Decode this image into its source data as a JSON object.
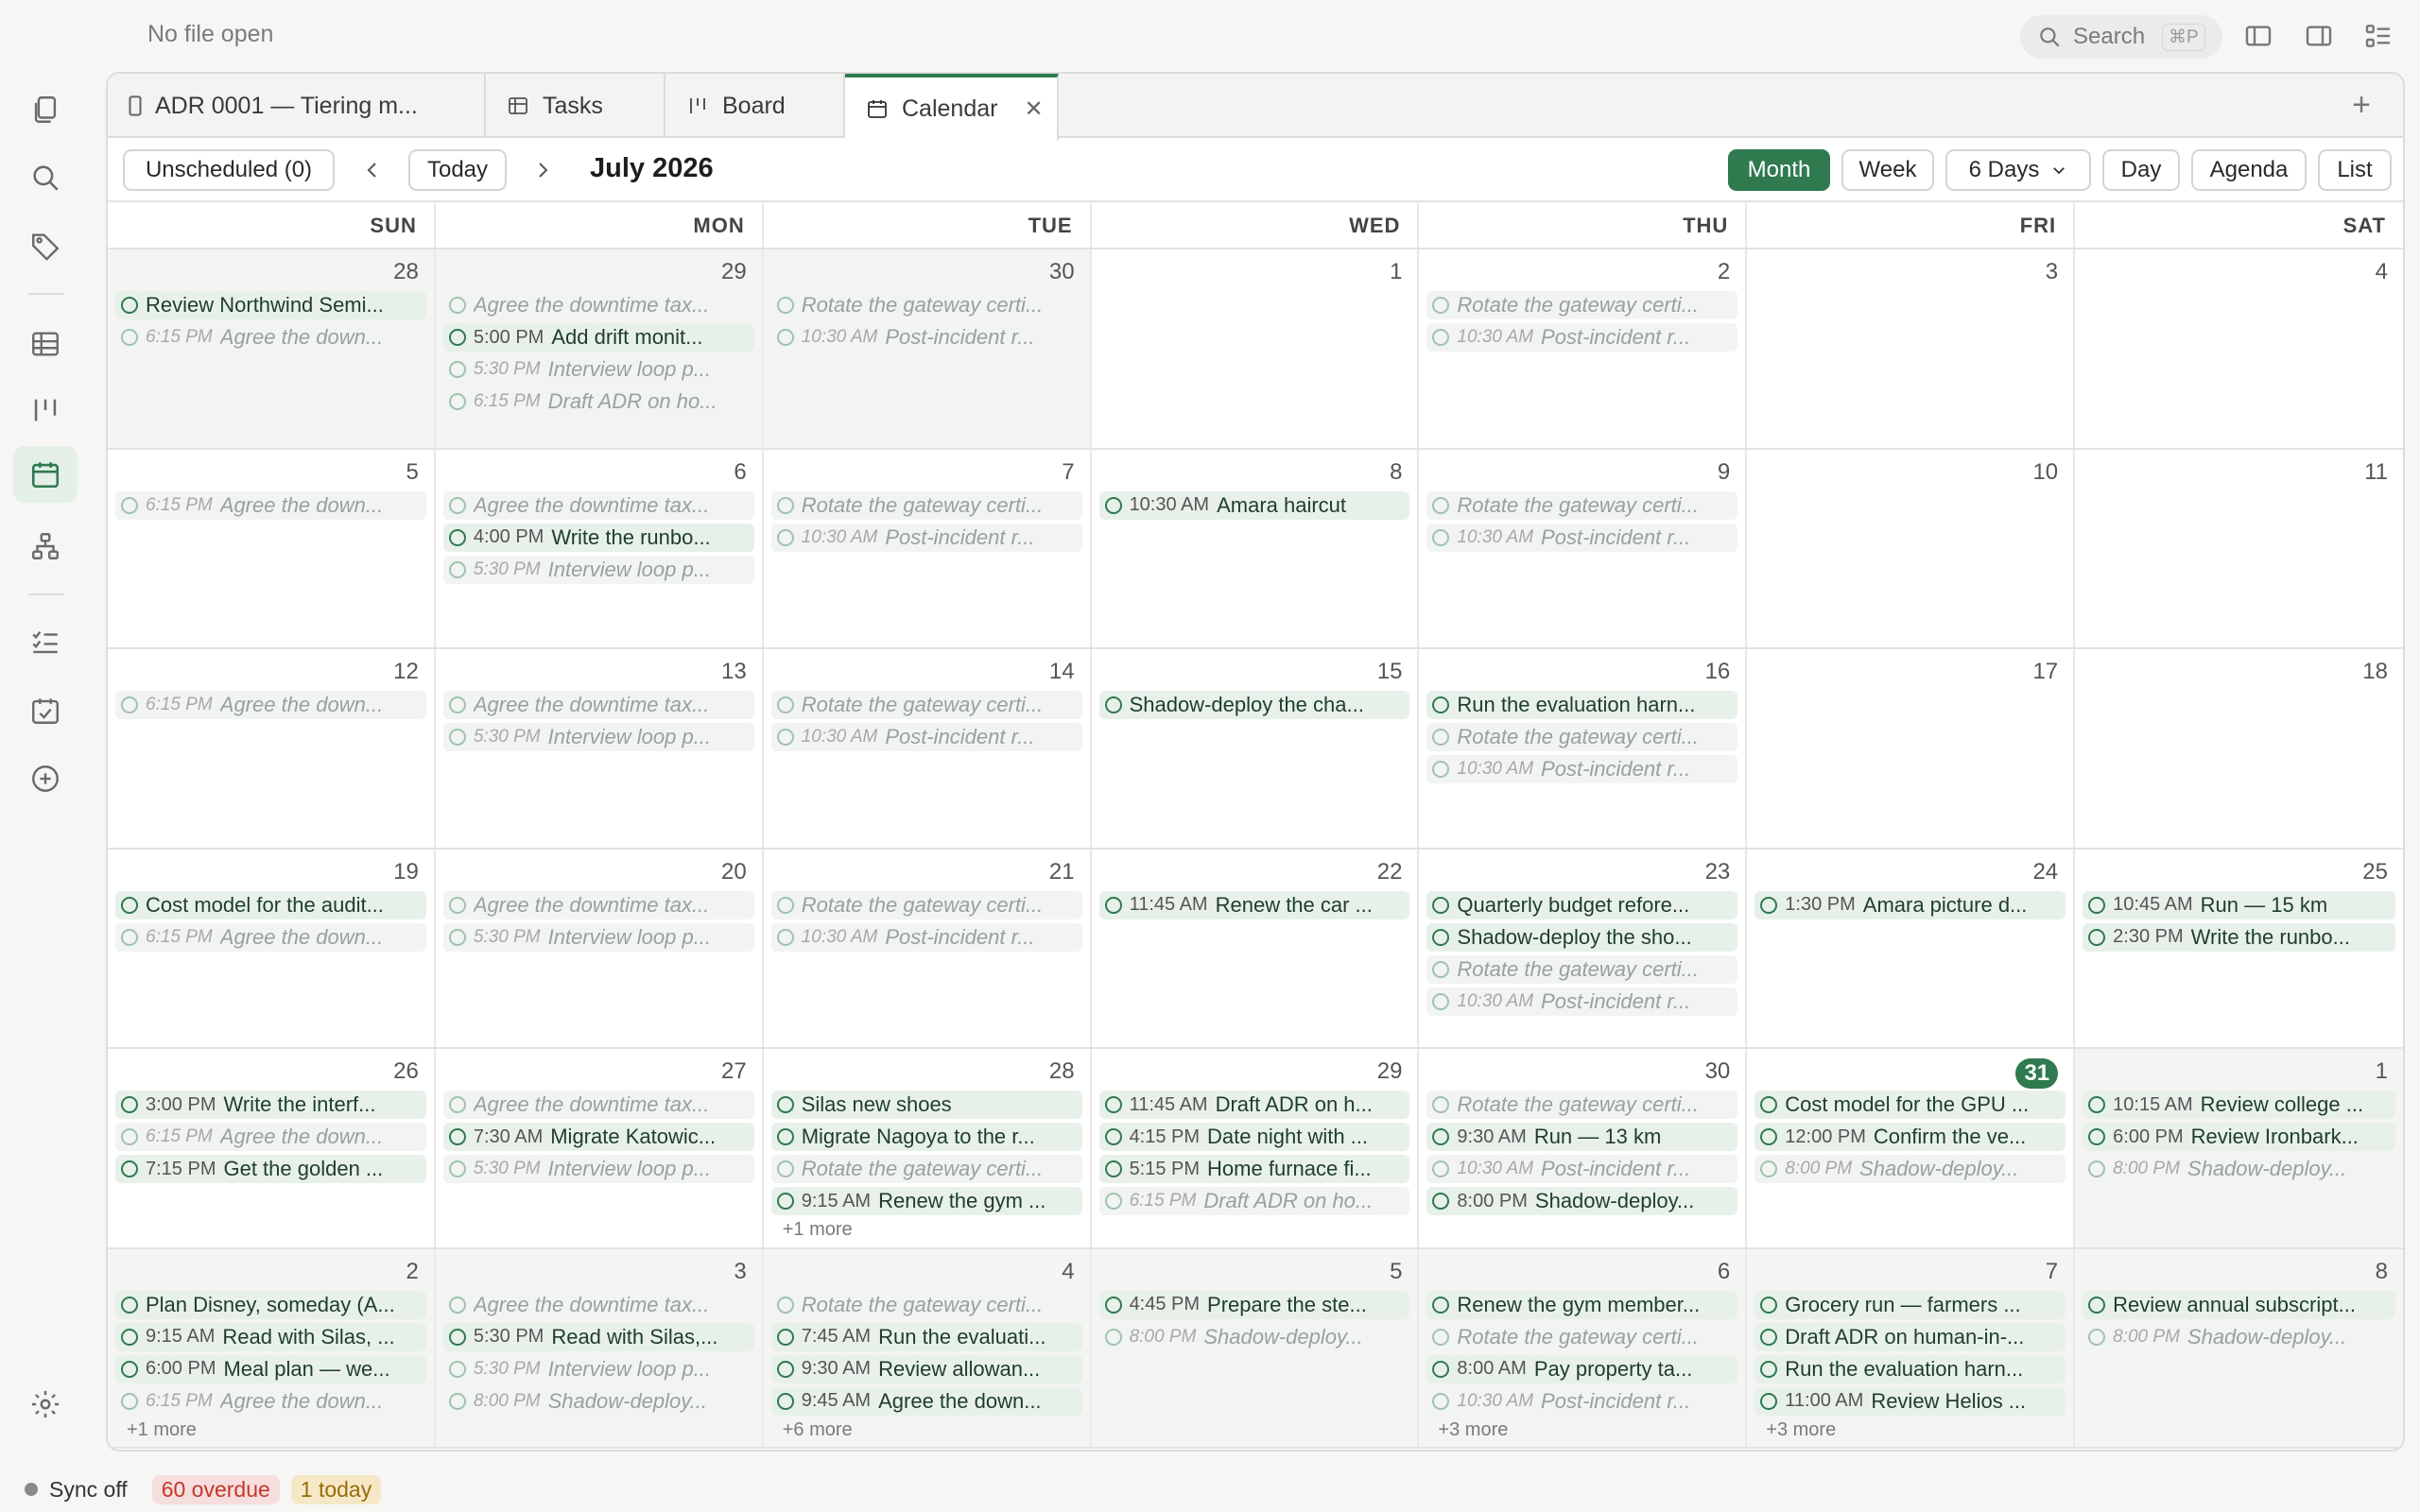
{
  "titlebar": {
    "file_status": "No file open",
    "search_label": "Search",
    "search_shortcut": "⌘P"
  },
  "tabs": [
    {
      "label": "ADR 0001 — Tiering m...",
      "icon": "file-icon"
    },
    {
      "label": "Tasks",
      "icon": "table-icon"
    },
    {
      "label": "Board",
      "icon": "board-icon"
    },
    {
      "label": "Calendar",
      "icon": "calendar-icon",
      "active": true
    }
  ],
  "toolbar": {
    "unscheduled": "Unscheduled (0)",
    "today": "Today",
    "title": "July 2026",
    "views": {
      "month": "Month",
      "week": "Week",
      "six_days": "6 Days",
      "day": "Day",
      "agenda": "Agenda",
      "list": "List"
    }
  },
  "days_of_week": [
    "SUN",
    "MON",
    "TUE",
    "WED",
    "THU",
    "FRI",
    "SAT"
  ],
  "weeks": [
    [
      {
        "day": "28",
        "other": true,
        "events": [
          {
            "title": "Review Northwind Semi...",
            "time": "",
            "style": "active"
          },
          {
            "title": "Agree the down...",
            "time": "6:15 PM",
            "style": "faded"
          }
        ]
      },
      {
        "day": "29",
        "other": true,
        "events": [
          {
            "title": "Agree the downtime tax...",
            "time": "",
            "style": "faded"
          },
          {
            "title": "Add drift monit...",
            "time": "5:00 PM",
            "style": "active"
          },
          {
            "title": "Interview loop p...",
            "time": "5:30 PM",
            "style": "faded"
          },
          {
            "title": "Draft ADR on ho...",
            "time": "6:15 PM",
            "style": "faded"
          }
        ]
      },
      {
        "day": "30",
        "other": true,
        "events": [
          {
            "title": "Rotate the gateway certi...",
            "time": "",
            "style": "faded"
          },
          {
            "title": "Post-incident r...",
            "time": "10:30 AM",
            "style": "faded"
          }
        ]
      },
      {
        "day": "1",
        "events": []
      },
      {
        "day": "2",
        "events": [
          {
            "title": "Rotate the gateway certi...",
            "time": "",
            "style": "faded"
          },
          {
            "title": "Post-incident r...",
            "time": "10:30 AM",
            "style": "faded"
          }
        ]
      },
      {
        "day": "3",
        "events": []
      },
      {
        "day": "4",
        "events": []
      }
    ],
    [
      {
        "day": "5",
        "events": [
          {
            "title": "Agree the down...",
            "time": "6:15 PM",
            "style": "faded"
          }
        ]
      },
      {
        "day": "6",
        "events": [
          {
            "title": "Agree the downtime tax...",
            "time": "",
            "style": "faded"
          },
          {
            "title": "Write the runbo...",
            "time": "4:00 PM",
            "style": "active"
          },
          {
            "title": "Interview loop p...",
            "time": "5:30 PM",
            "style": "faded"
          }
        ]
      },
      {
        "day": "7",
        "events": [
          {
            "title": "Rotate the gateway certi...",
            "time": "",
            "style": "faded"
          },
          {
            "title": "Post-incident r...",
            "time": "10:30 AM",
            "style": "faded"
          }
        ]
      },
      {
        "day": "8",
        "events": [
          {
            "title": "Amara haircut",
            "time": "10:30 AM",
            "style": "active"
          }
        ]
      },
      {
        "day": "9",
        "events": [
          {
            "title": "Rotate the gateway certi...",
            "time": "",
            "style": "faded"
          },
          {
            "title": "Post-incident r...",
            "time": "10:30 AM",
            "style": "faded"
          }
        ]
      },
      {
        "day": "10",
        "events": []
      },
      {
        "day": "11",
        "events": []
      }
    ],
    [
      {
        "day": "12",
        "events": [
          {
            "title": "Agree the down...",
            "time": "6:15 PM",
            "style": "faded"
          }
        ]
      },
      {
        "day": "13",
        "events": [
          {
            "title": "Agree the downtime tax...",
            "time": "",
            "style": "faded"
          },
          {
            "title": "Interview loop p...",
            "time": "5:30 PM",
            "style": "faded"
          }
        ]
      },
      {
        "day": "14",
        "events": [
          {
            "title": "Rotate the gateway certi...",
            "time": "",
            "style": "faded"
          },
          {
            "title": "Post-incident r...",
            "time": "10:30 AM",
            "style": "faded"
          }
        ]
      },
      {
        "day": "15",
        "events": [
          {
            "title": "Shadow-deploy the cha...",
            "time": "",
            "style": "active"
          }
        ]
      },
      {
        "day": "16",
        "events": [
          {
            "title": "Run the evaluation harn...",
            "time": "",
            "style": "active"
          },
          {
            "title": "Rotate the gateway certi...",
            "time": "",
            "style": "faded"
          },
          {
            "title": "Post-incident r...",
            "time": "10:30 AM",
            "style": "faded"
          }
        ]
      },
      {
        "day": "17",
        "events": []
      },
      {
        "day": "18",
        "events": []
      }
    ],
    [
      {
        "day": "19",
        "events": [
          {
            "title": "Cost model for the audit...",
            "time": "",
            "style": "active"
          },
          {
            "title": "Agree the down...",
            "time": "6:15 PM",
            "style": "faded"
          }
        ]
      },
      {
        "day": "20",
        "events": [
          {
            "title": "Agree the downtime tax...",
            "time": "",
            "style": "faded"
          },
          {
            "title": "Interview loop p...",
            "time": "5:30 PM",
            "style": "faded"
          }
        ]
      },
      {
        "day": "21",
        "events": [
          {
            "title": "Rotate the gateway certi...",
            "time": "",
            "style": "faded"
          },
          {
            "title": "Post-incident r...",
            "time": "10:30 AM",
            "style": "faded"
          }
        ]
      },
      {
        "day": "22",
        "events": [
          {
            "title": "Renew the car ...",
            "time": "11:45 AM",
            "style": "active"
          }
        ]
      },
      {
        "day": "23",
        "events": [
          {
            "title": "Quarterly budget refore...",
            "time": "",
            "style": "active"
          },
          {
            "title": "Shadow-deploy the sho...",
            "time": "",
            "style": "active"
          },
          {
            "title": "Rotate the gateway certi...",
            "time": "",
            "style": "faded"
          },
          {
            "title": "Post-incident r...",
            "time": "10:30 AM",
            "style": "faded"
          }
        ]
      },
      {
        "day": "24",
        "events": [
          {
            "title": "Amara picture d...",
            "time": "1:30 PM",
            "style": "active"
          }
        ]
      },
      {
        "day": "25",
        "events": [
          {
            "title": "Run — 15 km",
            "time": "10:45 AM",
            "style": "active"
          },
          {
            "title": "Write the runbo...",
            "time": "2:30 PM",
            "style": "active"
          }
        ]
      }
    ],
    [
      {
        "day": "26",
        "events": [
          {
            "title": "Write the interf...",
            "time": "3:00 PM",
            "style": "active"
          },
          {
            "title": "Agree the down...",
            "time": "6:15 PM",
            "style": "faded"
          },
          {
            "title": "Get the golden ...",
            "time": "7:15 PM",
            "style": "active"
          }
        ]
      },
      {
        "day": "27",
        "events": [
          {
            "title": "Agree the downtime tax...",
            "time": "",
            "style": "faded"
          },
          {
            "title": "Migrate Katowic...",
            "time": "7:30 AM",
            "style": "active"
          },
          {
            "title": "Interview loop p...",
            "time": "5:30 PM",
            "style": "faded"
          }
        ]
      },
      {
        "day": "28",
        "more": "+1 more",
        "events": [
          {
            "title": "Silas new shoes",
            "time": "",
            "style": "active"
          },
          {
            "title": "Migrate Nagoya to the r...",
            "time": "",
            "style": "active"
          },
          {
            "title": "Rotate the gateway certi...",
            "time": "",
            "style": "faded"
          },
          {
            "title": "Renew the gym ...",
            "time": "9:15 AM",
            "style": "active"
          }
        ]
      },
      {
        "day": "29",
        "events": [
          {
            "title": "Draft ADR on h...",
            "time": "11:45 AM",
            "style": "active"
          },
          {
            "title": "Date night with ...",
            "time": "4:15 PM",
            "style": "active"
          },
          {
            "title": "Home furnace fi...",
            "time": "5:15 PM",
            "style": "active"
          },
          {
            "title": "Draft ADR on ho...",
            "time": "6:15 PM",
            "style": "faded"
          }
        ]
      },
      {
        "day": "30",
        "events": [
          {
            "title": "Rotate the gateway certi...",
            "time": "",
            "style": "faded"
          },
          {
            "title": "Run — 13 km",
            "time": "9:30 AM",
            "style": "active"
          },
          {
            "title": "Post-incident r...",
            "time": "10:30 AM",
            "style": "faded"
          },
          {
            "title": "Shadow-deploy...",
            "time": "8:00 PM",
            "style": "active"
          }
        ]
      },
      {
        "day": "31",
        "today": true,
        "events": [
          {
            "title": "Cost model for the GPU ...",
            "time": "",
            "style": "active"
          },
          {
            "title": "Confirm the ve...",
            "time": "12:00 PM",
            "style": "active"
          },
          {
            "title": "Shadow-deploy...",
            "time": "8:00 PM",
            "style": "faded"
          }
        ]
      },
      {
        "day": "1",
        "other": true,
        "events": [
          {
            "title": "Review college ...",
            "time": "10:15 AM",
            "style": "active"
          },
          {
            "title": "Review Ironbark...",
            "time": "6:00 PM",
            "style": "active"
          },
          {
            "title": "Shadow-deploy...",
            "time": "8:00 PM",
            "style": "faded"
          }
        ]
      }
    ],
    [
      {
        "day": "2",
        "other": true,
        "more": "+1 more",
        "events": [
          {
            "title": "Plan Disney, someday (A...",
            "time": "",
            "style": "active"
          },
          {
            "title": "Read with Silas, ...",
            "time": "9:15 AM",
            "style": "active"
          },
          {
            "title": "Meal plan — we...",
            "time": "6:00 PM",
            "style": "active"
          },
          {
            "title": "Agree the down...",
            "time": "6:15 PM",
            "style": "faded"
          }
        ]
      },
      {
        "day": "3",
        "other": true,
        "events": [
          {
            "title": "Agree the downtime tax...",
            "time": "",
            "style": "faded"
          },
          {
            "title": "Read with Silas,...",
            "time": "5:30 PM",
            "style": "active"
          },
          {
            "title": "Interview loop p...",
            "time": "5:30 PM",
            "style": "faded"
          },
          {
            "title": "Shadow-deploy...",
            "time": "8:00 PM",
            "style": "faded"
          }
        ]
      },
      {
        "day": "4",
        "other": true,
        "more": "+6 more",
        "events": [
          {
            "title": "Rotate the gateway certi...",
            "time": "",
            "style": "faded"
          },
          {
            "title": "Run the evaluati...",
            "time": "7:45 AM",
            "style": "active"
          },
          {
            "title": "Review allowan...",
            "time": "9:30 AM",
            "style": "active"
          },
          {
            "title": "Agree the down...",
            "time": "9:45 AM",
            "style": "active"
          }
        ]
      },
      {
        "day": "5",
        "other": true,
        "events": [
          {
            "title": "Prepare the ste...",
            "time": "4:45 PM",
            "style": "active"
          },
          {
            "title": "Shadow-deploy...",
            "time": "8:00 PM",
            "style": "faded"
          }
        ]
      },
      {
        "day": "6",
        "other": true,
        "more": "+3 more",
        "events": [
          {
            "title": "Renew the gym member...",
            "time": "",
            "style": "active"
          },
          {
            "title": "Rotate the gateway certi...",
            "time": "",
            "style": "faded"
          },
          {
            "title": "Pay property ta...",
            "time": "8:00 AM",
            "style": "active"
          },
          {
            "title": "Post-incident r...",
            "time": "10:30 AM",
            "style": "faded"
          }
        ]
      },
      {
        "day": "7",
        "other": true,
        "more": "+3 more",
        "events": [
          {
            "title": "Grocery run — farmers ...",
            "time": "",
            "style": "active"
          },
          {
            "title": "Draft ADR on human-in-...",
            "time": "",
            "style": "active"
          },
          {
            "title": "Run the evaluation harn...",
            "time": "",
            "style": "active"
          },
          {
            "title": "Review Helios ...",
            "time": "11:00 AM",
            "style": "active"
          }
        ]
      },
      {
        "day": "8",
        "other": true,
        "events": [
          {
            "title": "Review annual subscript...",
            "time": "",
            "style": "active"
          },
          {
            "title": "Shadow-deploy...",
            "time": "8:00 PM",
            "style": "faded"
          }
        ]
      }
    ]
  ],
  "status": {
    "sync": "Sync off",
    "overdue": "60 overdue",
    "today": "1 today"
  },
  "colors": {
    "accent": "#2f7a4f",
    "event_bg": "#e7f1ea"
  }
}
